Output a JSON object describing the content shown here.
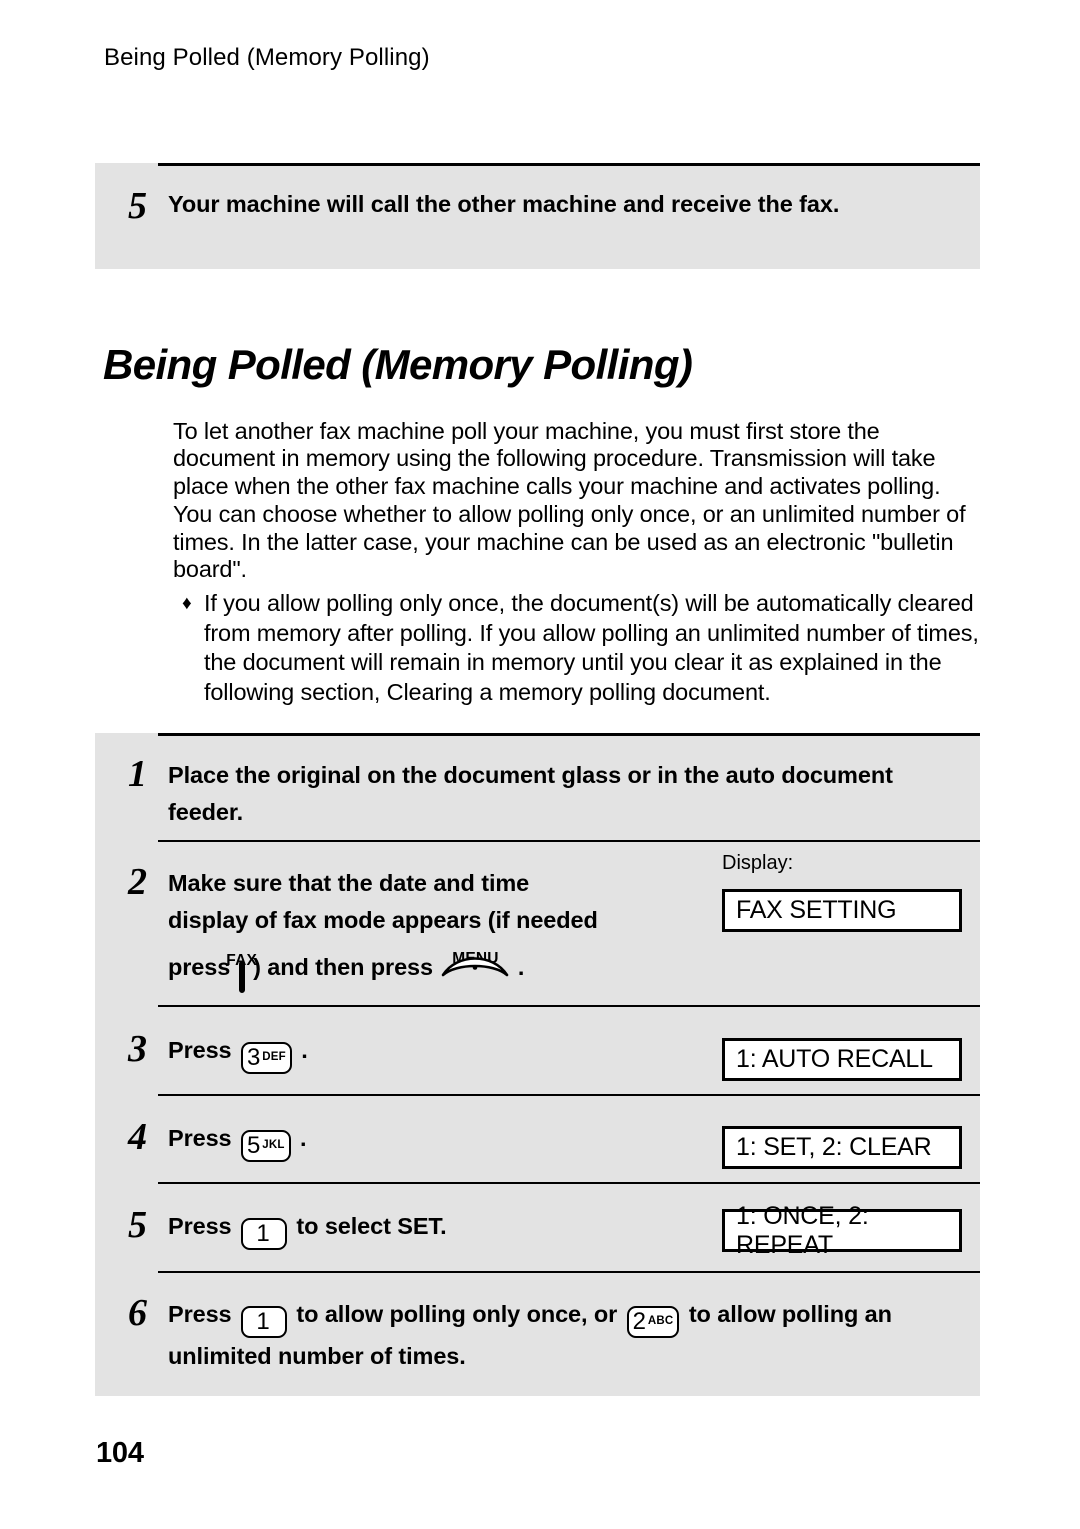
{
  "page": {
    "running_header": "Being Polled (Memory Polling)",
    "title": "Being Polled (Memory Polling)",
    "page_number": "104"
  },
  "top_step": {
    "number": "5",
    "text": "Your machine will call the other machine and receive the fax."
  },
  "intro": {
    "paragraph": "To let another fax machine poll your machine, you must first store the document in memory using the following procedure. Transmission will take place when the other fax machine calls your machine and activates polling. You can choose whether to allow polling only once, or an unlimited number of times. In the latter case, your machine can be used as an electronic \"bulletin board\".",
    "bullet_marker": "♦",
    "bullet_text": "If you allow polling only once, the document(s) will be automatically cleared from memory after polling. If you allow polling an unlimited number of times, the document will remain in memory until you clear it as explained in the following section, Clearing a memory polling document."
  },
  "display_column": {
    "label": "Display:",
    "boxes": [
      {
        "value": "FAX SETTING"
      },
      {
        "value": "1: AUTO RECALL"
      },
      {
        "value": "1: SET, 2: CLEAR"
      },
      {
        "value": "1: ONCE, 2: REPEAT"
      }
    ]
  },
  "steps": [
    {
      "number": "1",
      "text": "Place the original on the document glass or in the auto document feeder."
    },
    {
      "number": "2",
      "line1": "Make sure that the date and time",
      "line2": "display of fax mode appears (if needed",
      "line3_a": "press",
      "line3_b": ") and then press",
      "line3_c": ".",
      "fax_key_label": "FAX",
      "menu_key_label": "MENU"
    },
    {
      "number": "3",
      "press_label": "Press",
      "key_digit": "3",
      "key_letters": "DEF",
      "trailing": "."
    },
    {
      "number": "4",
      "press_label": "Press",
      "key_digit": "5",
      "key_letters": "JKL",
      "trailing": "."
    },
    {
      "number": "5",
      "press_label": "Press",
      "key_digit": "1",
      "key_letters": "",
      "trailing": "to select SET."
    },
    {
      "number": "6",
      "press_label": "Press",
      "key1_digit": "1",
      "key1_letters": "",
      "mid_text": "to allow polling only once, or",
      "key2_digit": "2",
      "key2_letters": "ABC",
      "tail_text": "to allow polling an",
      "line2": "unlimited number of times."
    }
  ],
  "colors": {
    "panel_background": "#e3e3e3",
    "page_background": "#ffffff",
    "text": "#000000",
    "display_box_fill": "#ffffff"
  }
}
